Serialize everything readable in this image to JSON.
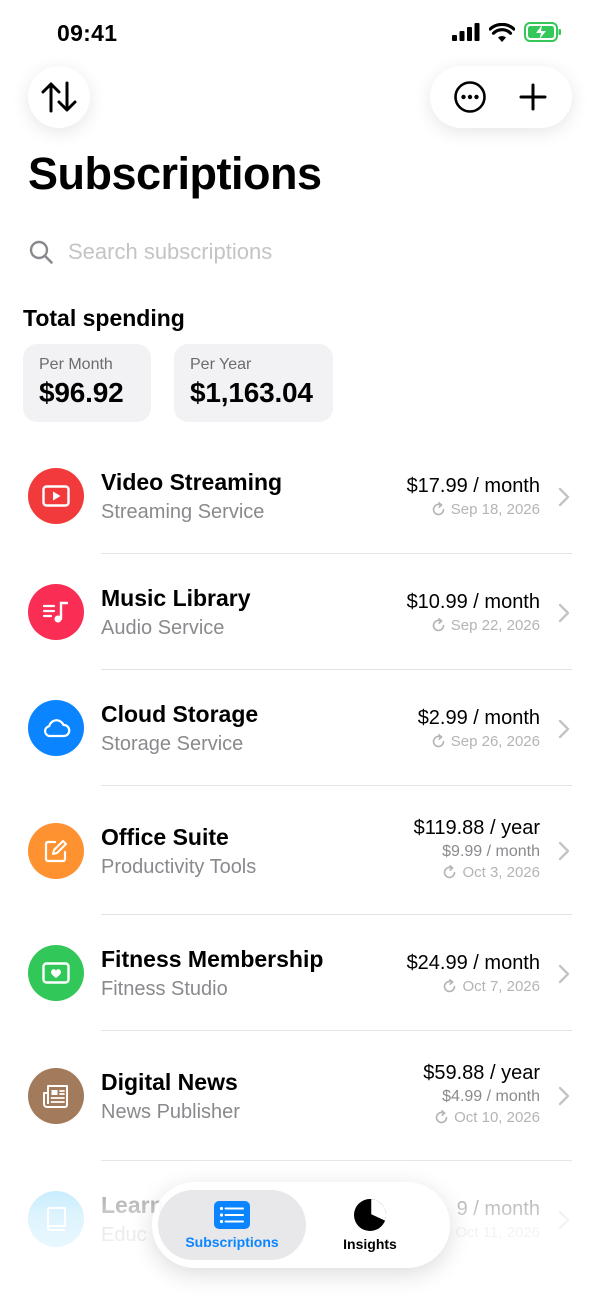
{
  "status": {
    "time": "09:41"
  },
  "header": {
    "title": "Subscriptions",
    "sort_icon": "sort-arrows-icon",
    "more_icon": "ellipsis-circle-icon",
    "add_icon": "plus-icon"
  },
  "search": {
    "placeholder": "Search subscriptions",
    "value": ""
  },
  "total": {
    "title": "Total spending",
    "per_month_label": "Per Month",
    "per_month_value": "$96.92",
    "per_year_label": "Per Year",
    "per_year_value": "$1,163.04"
  },
  "subscriptions": [
    {
      "name": "Video Streaming",
      "provider": "Streaming Service",
      "price": "$17.99 / month",
      "monthly": "",
      "renewal": "Sep 18, 2026",
      "color": "#f23a3c",
      "icon": "play-icon"
    },
    {
      "name": "Music Library",
      "provider": "Audio Service",
      "price": "$10.99 / month",
      "monthly": "",
      "renewal": "Sep 22, 2026",
      "color": "#fa2d55",
      "icon": "music-list-icon"
    },
    {
      "name": "Cloud Storage",
      "provider": "Storage Service",
      "price": "$2.99 / month",
      "monthly": "",
      "renewal": "Sep 26, 2026",
      "color": "#0a84ff",
      "icon": "cloud-icon"
    },
    {
      "name": "Office Suite",
      "provider": "Productivity Tools",
      "price": "$119.88 / year",
      "monthly": "$9.99 / month",
      "renewal": "Oct 3, 2026",
      "color": "#ff9230",
      "icon": "edit-square-icon"
    },
    {
      "name": "Fitness Membership",
      "provider": "Fitness Studio",
      "price": "$24.99 / month",
      "monthly": "",
      "renewal": "Oct 7, 2026",
      "color": "#32c759",
      "icon": "heart-card-icon"
    },
    {
      "name": "Digital News",
      "provider": "News Publisher",
      "price": "$59.88 / year",
      "monthly": "$4.99 / month",
      "renewal": "Oct 10, 2026",
      "color": "#a27a5c",
      "icon": "newspaper-icon"
    },
    {
      "name": "Learn",
      "provider": "Educ",
      "price": "9 / month",
      "monthly": "",
      "renewal": "Oct 11, 2026",
      "color": "#5ac8fa",
      "icon": "book-icon"
    }
  ],
  "tabs": [
    {
      "label": "Subscriptions",
      "icon": "list-icon",
      "active": true,
      "color": "#0a84ff"
    },
    {
      "label": "Insights",
      "icon": "pie-chart-icon",
      "active": false,
      "color": "#000000"
    }
  ]
}
